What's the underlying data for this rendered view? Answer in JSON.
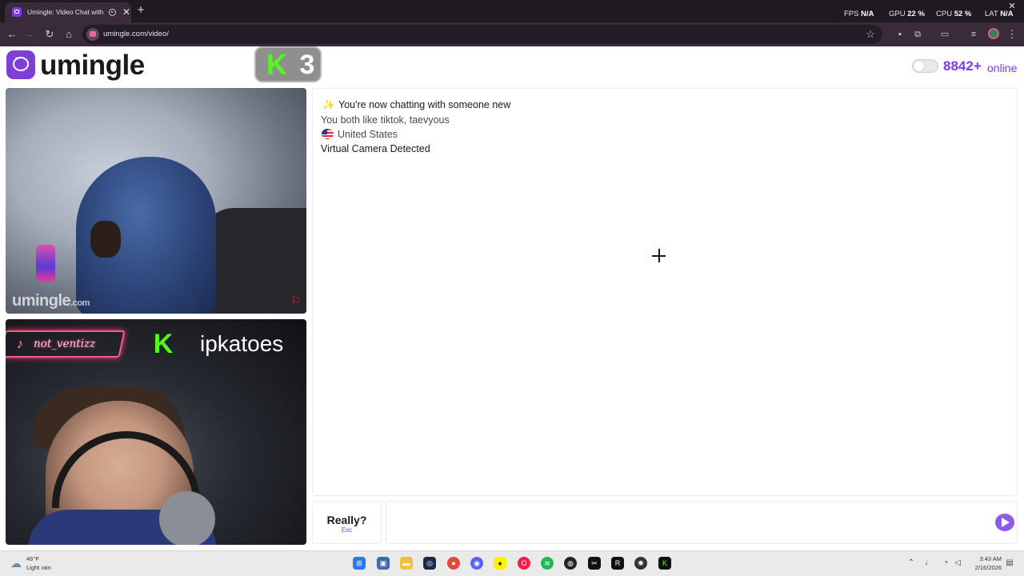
{
  "browser": {
    "tab_title": "Umingle: Video Chat with S",
    "tab_close": "✕",
    "new_tab": "+",
    "url": "umingle.com/video/",
    "stats": {
      "fps_label": "FPS",
      "fps_value": "N/A",
      "gpu_label": "GPU",
      "gpu_value": "22 %",
      "cpu_label": "CPU",
      "cpu_value": "52 %",
      "lat_label": "LAT",
      "lat_value": "N/A"
    }
  },
  "header": {
    "logo_text": "umingle",
    "kick_count": "3",
    "online_count": "8842+",
    "online_label": "online"
  },
  "video": {
    "watermark_main": "umingle",
    "watermark_suffix": ".com",
    "tiktok_handle": "not_ventizz",
    "kick_username": "ipkatoes"
  },
  "chat": {
    "messages": {
      "new_chat": "You're now chatting with someone new",
      "interests": "You both like tiktok, taevyous",
      "country": "United States",
      "camera": "Virtual Camera Detected"
    },
    "skip_label": "Really?",
    "skip_key": "Esc",
    "input_placeholder": ""
  },
  "taskbar": {
    "weather_temp": "46°F",
    "weather_desc": "Light rain",
    "time": "3:43 AM",
    "date": "2/16/2026",
    "apps": [
      "windows-start",
      "task-view",
      "file-explorer",
      "steam",
      "chrome",
      "discord",
      "snapchat",
      "opera-gx",
      "spotify",
      "obs",
      "capcut",
      "recording",
      "chatgpt",
      "kick"
    ]
  },
  "colors": {
    "brand_purple": "#7c3aed",
    "kick_green": "#53fc18",
    "browser_dark": "#1f1a20"
  }
}
